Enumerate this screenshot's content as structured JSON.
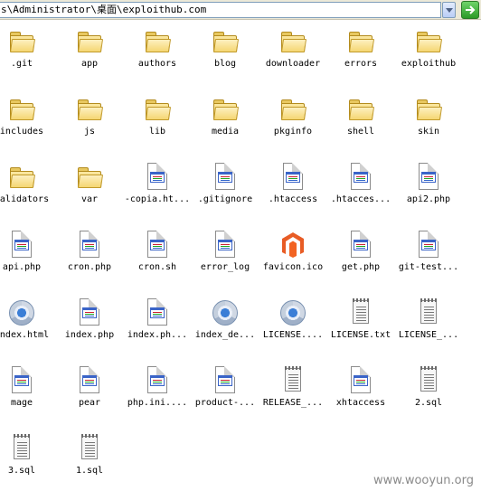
{
  "address_bar": {
    "path": "s\\Administrator\\桌面\\exploithub.com",
    "go_icon": "go-arrow-icon"
  },
  "items": [
    {
      "label": ".git",
      "icon": "folder-icon"
    },
    {
      "label": "app",
      "icon": "folder-icon"
    },
    {
      "label": "authors",
      "icon": "folder-icon"
    },
    {
      "label": "blog",
      "icon": "folder-icon"
    },
    {
      "label": "downloader",
      "icon": "folder-icon"
    },
    {
      "label": "errors",
      "icon": "folder-icon"
    },
    {
      "label": "exploithub",
      "icon": "folder-icon"
    },
    {
      "label": "includes",
      "icon": "folder-icon"
    },
    {
      "label": "js",
      "icon": "folder-icon"
    },
    {
      "label": "lib",
      "icon": "folder-icon"
    },
    {
      "label": "media",
      "icon": "folder-icon"
    },
    {
      "label": "pkginfo",
      "icon": "folder-icon"
    },
    {
      "label": "shell",
      "icon": "folder-icon"
    },
    {
      "label": "skin",
      "icon": "folder-icon"
    },
    {
      "label": "validators",
      "icon": "folder-icon"
    },
    {
      "label": "var",
      "icon": "folder-icon"
    },
    {
      "label": "-copia.ht...",
      "icon": "file-icon"
    },
    {
      "label": ".gitignore",
      "icon": "file-icon"
    },
    {
      "label": ".htaccess",
      "icon": "file-icon"
    },
    {
      "label": ".htacces...",
      "icon": "file-icon"
    },
    {
      "label": "api2.php",
      "icon": "file-icon"
    },
    {
      "label": "api.php",
      "icon": "file-icon"
    },
    {
      "label": "cron.php",
      "icon": "file-icon"
    },
    {
      "label": "cron.sh",
      "icon": "file-icon"
    },
    {
      "label": "error_log",
      "icon": "file-icon"
    },
    {
      "label": "favicon.ico",
      "icon": "magento-logo-icon"
    },
    {
      "label": "get.php",
      "icon": "file-icon"
    },
    {
      "label": "git-test...",
      "icon": "file-icon"
    },
    {
      "label": "index.html",
      "icon": "chrome-html-icon"
    },
    {
      "label": "index.php",
      "icon": "file-icon"
    },
    {
      "label": "index.ph...",
      "icon": "file-icon"
    },
    {
      "label": "index_de...",
      "icon": "chrome-html-icon"
    },
    {
      "label": "LICENSE....",
      "icon": "chrome-html-icon"
    },
    {
      "label": "LICENSE.txt",
      "icon": "text-file-icon"
    },
    {
      "label": "LICENSE_...",
      "icon": "text-file-icon"
    },
    {
      "label": "mage",
      "icon": "file-icon"
    },
    {
      "label": "pear",
      "icon": "file-icon"
    },
    {
      "label": "php.ini....",
      "icon": "file-icon"
    },
    {
      "label": "product-...",
      "icon": "file-icon"
    },
    {
      "label": "RELEASE_...",
      "icon": "text-file-icon"
    },
    {
      "label": "xhtaccess",
      "icon": "file-icon"
    },
    {
      "label": "2.sql",
      "icon": "text-file-icon"
    },
    {
      "label": "3.sql",
      "icon": "text-file-icon"
    },
    {
      "label": "1.sql",
      "icon": "text-file-icon"
    }
  ],
  "watermark": "www.wooyun.org"
}
